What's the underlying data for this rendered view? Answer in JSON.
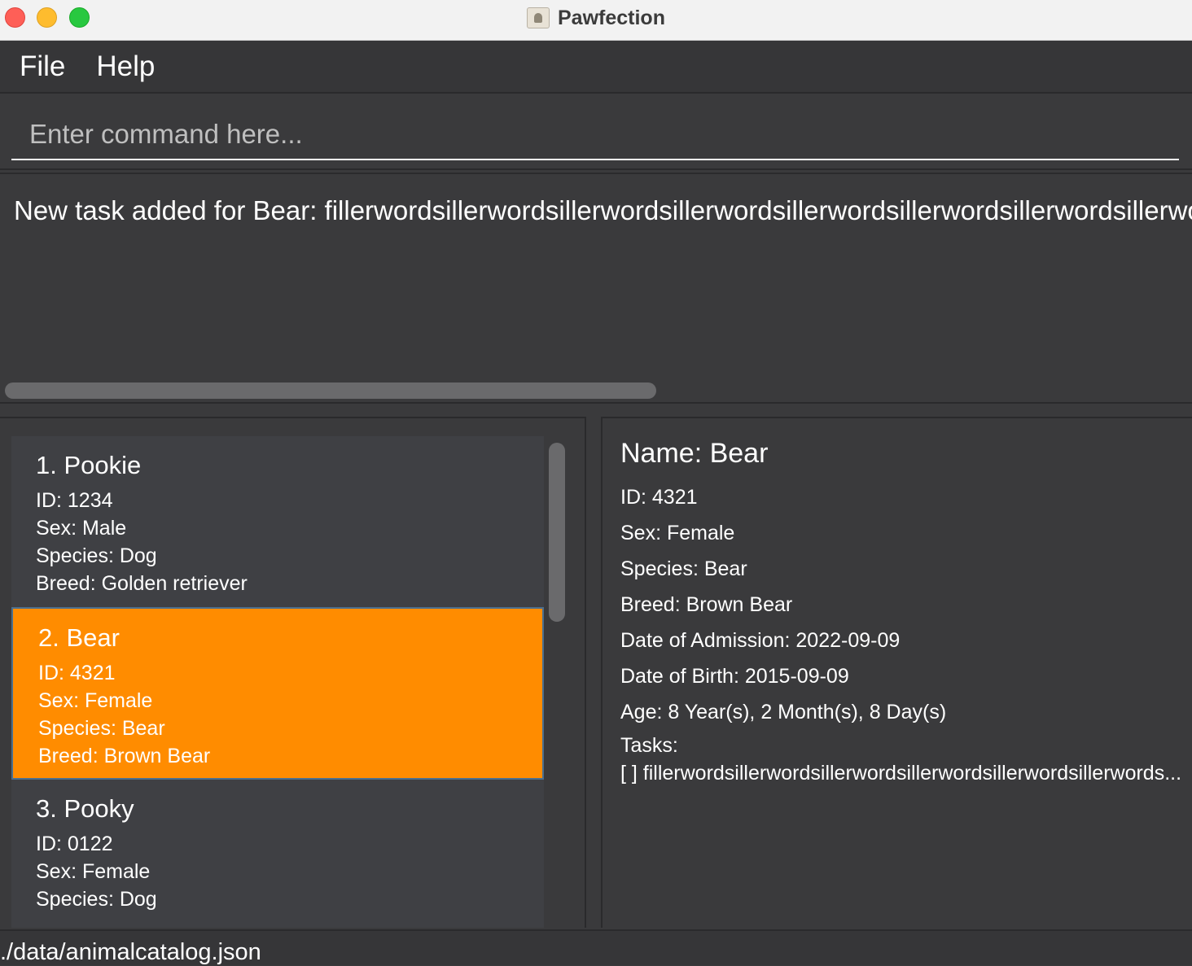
{
  "window": {
    "title": "Pawfection"
  },
  "menu": {
    "file": "File",
    "help": "Help"
  },
  "command": {
    "placeholder": "Enter command here..."
  },
  "result": {
    "text": "New task added for Bear: fillerwordsillerwordsillerwordsillerwordsillerwordsillerwordsillerwordsillerwo"
  },
  "animals": [
    {
      "name": "1.  Pookie",
      "id": "ID: 1234",
      "sex": "Sex: Male",
      "species": "Species: Dog",
      "breed": "Breed: Golden retriever"
    },
    {
      "name": "2.  Bear",
      "id": "ID: 4321",
      "sex": "Sex: Female",
      "species": "Species: Bear",
      "breed": "Breed: Brown Bear"
    },
    {
      "name": "3.  Pooky",
      "id": "ID: 0122",
      "sex": "Sex: Female",
      "species": "Species: Dog"
    }
  ],
  "detail": {
    "name": "Name: Bear",
    "id": "ID: 4321",
    "sex": "Sex: Female",
    "species": "Species: Bear",
    "breed": "Breed: Brown Bear",
    "admission": "Date of Admission: 2022-09-09",
    "birth": "Date of Birth: 2015-09-09",
    "age": "Age: 8 Year(s), 2 Month(s), 8 Day(s)",
    "tasks_label": "Tasks:",
    "task_1": "[ ] fillerwordsillerwordsillerwordsillerwordsillerwordsillerwords..."
  },
  "status": {
    "path": "./data/animalcatalog.json"
  },
  "colors": {
    "selected_card": "#ff8c00",
    "background": "#3a3a3c"
  }
}
